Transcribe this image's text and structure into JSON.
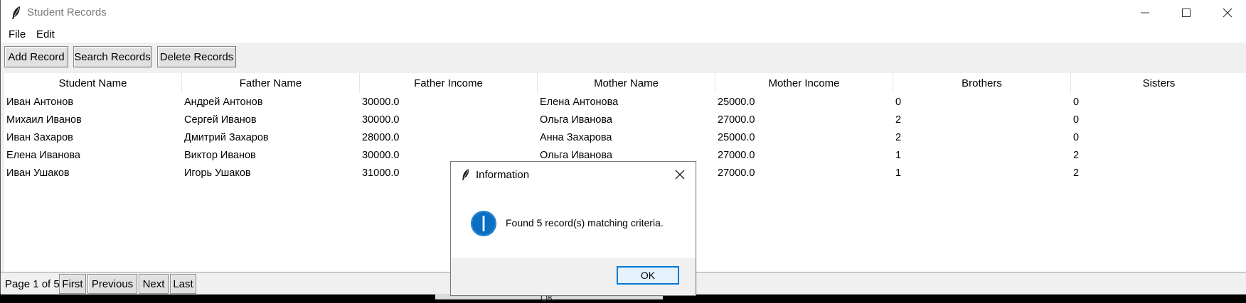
{
  "window": {
    "title": "Student Records"
  },
  "menu": {
    "items": [
      "File",
      "Edit"
    ]
  },
  "toolbar": {
    "add": "Add Record",
    "search": "Search Records",
    "delete": "Delete Records"
  },
  "table": {
    "columns": [
      "Student Name",
      "Father Name",
      "Father Income",
      "Mother Name",
      "Mother Income",
      "Brothers",
      "Sisters"
    ],
    "rows": [
      [
        "Иван Антонов",
        "Андрей Антонов",
        "30000.0",
        "Елена Антонова",
        "25000.0",
        "0",
        "0"
      ],
      [
        "Михаил Иванов",
        "Сергей Иванов",
        "30000.0",
        "Ольга Иванова",
        "27000.0",
        "2",
        "0"
      ],
      [
        "Иван Захаров",
        "Дмитрий Захаров",
        "28000.0",
        "Анна Захарова",
        "25000.0",
        "2",
        "0"
      ],
      [
        "Елена Иванова",
        "Виктор Иванов",
        "30000.0",
        "Ольга Иванова",
        "27000.0",
        "1",
        "2"
      ],
      [
        "Иван Ушаков",
        "Игорь Ушаков",
        "31000.0",
        "",
        "27000.0",
        "1",
        "2"
      ]
    ]
  },
  "pager": {
    "label": "Page 1 of 5",
    "first": "First",
    "previous": "Previous",
    "next": "Next",
    "last": "Last"
  },
  "dialog": {
    "title": "Information",
    "message": "Found 5 record(s) matching criteria.",
    "ok": "OK",
    "icon": "info-icon"
  },
  "background_fragment": {
    "text": "OK"
  },
  "colors": {
    "accent": "#0078d7",
    "info_icon": "#0a6fc2"
  }
}
